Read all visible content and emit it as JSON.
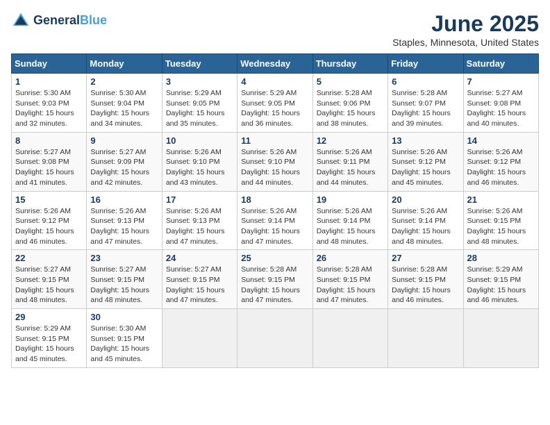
{
  "header": {
    "logo_line1": "General",
    "logo_line2": "Blue",
    "title": "June 2025",
    "subtitle": "Staples, Minnesota, United States"
  },
  "calendar": {
    "columns": [
      "Sunday",
      "Monday",
      "Tuesday",
      "Wednesday",
      "Thursday",
      "Friday",
      "Saturday"
    ],
    "weeks": [
      [
        {
          "day": "1",
          "sunrise": "5:30 AM",
          "sunset": "9:03 PM",
          "daylight": "15 hours and 32 minutes."
        },
        {
          "day": "2",
          "sunrise": "5:30 AM",
          "sunset": "9:04 PM",
          "daylight": "15 hours and 34 minutes."
        },
        {
          "day": "3",
          "sunrise": "5:29 AM",
          "sunset": "9:05 PM",
          "daylight": "15 hours and 35 minutes."
        },
        {
          "day": "4",
          "sunrise": "5:29 AM",
          "sunset": "9:05 PM",
          "daylight": "15 hours and 36 minutes."
        },
        {
          "day": "5",
          "sunrise": "5:28 AM",
          "sunset": "9:06 PM",
          "daylight": "15 hours and 38 minutes."
        },
        {
          "day": "6",
          "sunrise": "5:28 AM",
          "sunset": "9:07 PM",
          "daylight": "15 hours and 39 minutes."
        },
        {
          "day": "7",
          "sunrise": "5:27 AM",
          "sunset": "9:08 PM",
          "daylight": "15 hours and 40 minutes."
        }
      ],
      [
        {
          "day": "8",
          "sunrise": "5:27 AM",
          "sunset": "9:08 PM",
          "daylight": "15 hours and 41 minutes."
        },
        {
          "day": "9",
          "sunrise": "5:27 AM",
          "sunset": "9:09 PM",
          "daylight": "15 hours and 42 minutes."
        },
        {
          "day": "10",
          "sunrise": "5:26 AM",
          "sunset": "9:10 PM",
          "daylight": "15 hours and 43 minutes."
        },
        {
          "day": "11",
          "sunrise": "5:26 AM",
          "sunset": "9:10 PM",
          "daylight": "15 hours and 44 minutes."
        },
        {
          "day": "12",
          "sunrise": "5:26 AM",
          "sunset": "9:11 PM",
          "daylight": "15 hours and 44 minutes."
        },
        {
          "day": "13",
          "sunrise": "5:26 AM",
          "sunset": "9:12 PM",
          "daylight": "15 hours and 45 minutes."
        },
        {
          "day": "14",
          "sunrise": "5:26 AM",
          "sunset": "9:12 PM",
          "daylight": "15 hours and 46 minutes."
        }
      ],
      [
        {
          "day": "15",
          "sunrise": "5:26 AM",
          "sunset": "9:12 PM",
          "daylight": "15 hours and 46 minutes."
        },
        {
          "day": "16",
          "sunrise": "5:26 AM",
          "sunset": "9:13 PM",
          "daylight": "15 hours and 47 minutes."
        },
        {
          "day": "17",
          "sunrise": "5:26 AM",
          "sunset": "9:13 PM",
          "daylight": "15 hours and 47 minutes."
        },
        {
          "day": "18",
          "sunrise": "5:26 AM",
          "sunset": "9:14 PM",
          "daylight": "15 hours and 47 minutes."
        },
        {
          "day": "19",
          "sunrise": "5:26 AM",
          "sunset": "9:14 PM",
          "daylight": "15 hours and 48 minutes."
        },
        {
          "day": "20",
          "sunrise": "5:26 AM",
          "sunset": "9:14 PM",
          "daylight": "15 hours and 48 minutes."
        },
        {
          "day": "21",
          "sunrise": "5:26 AM",
          "sunset": "9:15 PM",
          "daylight": "15 hours and 48 minutes."
        }
      ],
      [
        {
          "day": "22",
          "sunrise": "5:27 AM",
          "sunset": "9:15 PM",
          "daylight": "15 hours and 48 minutes."
        },
        {
          "day": "23",
          "sunrise": "5:27 AM",
          "sunset": "9:15 PM",
          "daylight": "15 hours and 48 minutes."
        },
        {
          "day": "24",
          "sunrise": "5:27 AM",
          "sunset": "9:15 PM",
          "daylight": "15 hours and 47 minutes."
        },
        {
          "day": "25",
          "sunrise": "5:28 AM",
          "sunset": "9:15 PM",
          "daylight": "15 hours and 47 minutes."
        },
        {
          "day": "26",
          "sunrise": "5:28 AM",
          "sunset": "9:15 PM",
          "daylight": "15 hours and 47 minutes."
        },
        {
          "day": "27",
          "sunrise": "5:28 AM",
          "sunset": "9:15 PM",
          "daylight": "15 hours and 46 minutes."
        },
        {
          "day": "28",
          "sunrise": "5:29 AM",
          "sunset": "9:15 PM",
          "daylight": "15 hours and 46 minutes."
        }
      ],
      [
        {
          "day": "29",
          "sunrise": "5:29 AM",
          "sunset": "9:15 PM",
          "daylight": "15 hours and 45 minutes."
        },
        {
          "day": "30",
          "sunrise": "5:30 AM",
          "sunset": "9:15 PM",
          "daylight": "15 hours and 45 minutes."
        },
        null,
        null,
        null,
        null,
        null
      ]
    ]
  }
}
